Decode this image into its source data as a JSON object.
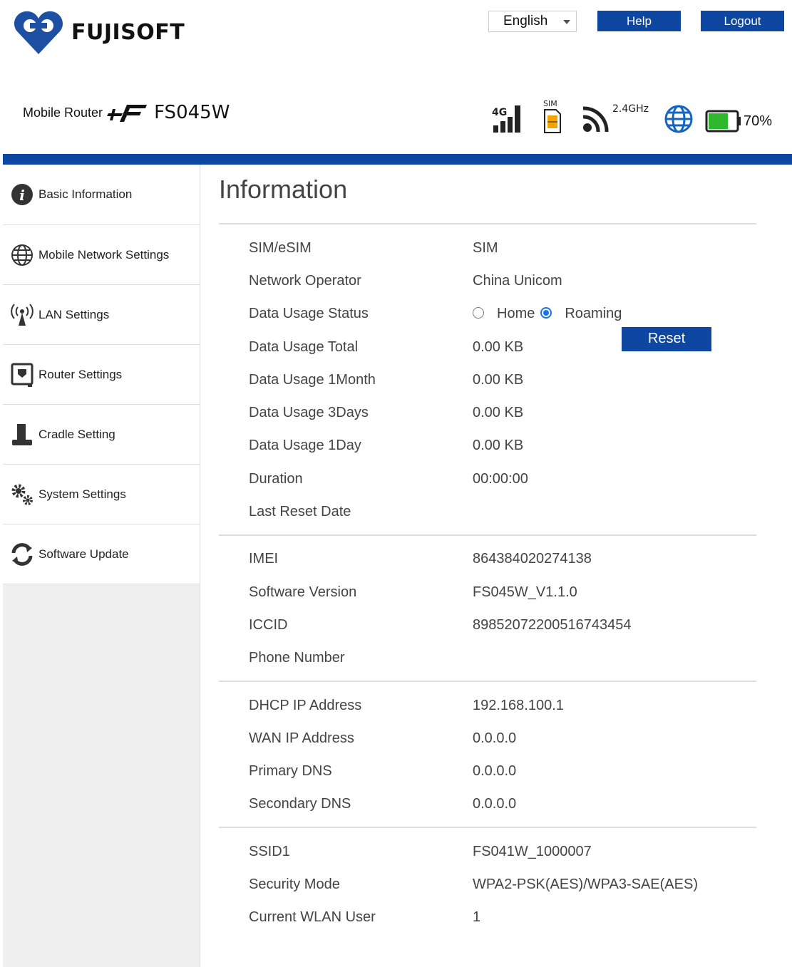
{
  "header": {
    "brand": "FUJISOFT",
    "language": "English",
    "help_label": "Help",
    "logout_label": "Logout",
    "product_prefix": "Mobile Router",
    "product_model": "FS045W"
  },
  "status": {
    "network_type": "4G",
    "sim_label": "SIM",
    "wifi_band": "2.4GHz",
    "battery_percent": "70%",
    "battery_level": 0.7,
    "battery_color": "#2eb82e"
  },
  "colors": {
    "accent": "#0d47a1"
  },
  "sidebar": {
    "items": [
      {
        "label": "Basic Information",
        "icon": "info-icon"
      },
      {
        "label": "Mobile Network Settings",
        "icon": "globe-icon"
      },
      {
        "label": "LAN Settings",
        "icon": "antenna-icon"
      },
      {
        "label": "Router Settings",
        "icon": "router-icon"
      },
      {
        "label": "Cradle Setting",
        "icon": "cradle-icon"
      },
      {
        "label": "System Settings",
        "icon": "gears-icon"
      },
      {
        "label": "Software Update",
        "icon": "refresh-icon"
      }
    ]
  },
  "main": {
    "title": "Information",
    "sim": {
      "label": "SIM/eSIM",
      "value": "SIM"
    },
    "operator": {
      "label": "Network Operator",
      "value": "China Unicom"
    },
    "usage_status": {
      "label": "Data Usage Status",
      "home": "Home",
      "roaming": "Roaming",
      "selected": "Roaming"
    },
    "usage_total": {
      "label": "Data Usage Total",
      "value": "0.00 KB",
      "reset_label": "Reset"
    },
    "usage_1month": {
      "label": "Data Usage 1Month",
      "value": "0.00 KB"
    },
    "usage_3days": {
      "label": "Data Usage 3Days",
      "value": "0.00 KB"
    },
    "usage_1day": {
      "label": "Data Usage 1Day",
      "value": "0.00 KB"
    },
    "duration": {
      "label": "Duration",
      "value": "00:00:00"
    },
    "last_reset": {
      "label": "Last Reset Date",
      "value": ""
    },
    "imei": {
      "label": "IMEI",
      "value": "864384020274138"
    },
    "software_version": {
      "label": "Software Version",
      "value": "FS045W_V1.1.0"
    },
    "iccid": {
      "label": "ICCID",
      "value": "89852072200516743454"
    },
    "phone": {
      "label": "Phone Number",
      "value": ""
    },
    "dhcp_ip": {
      "label": "DHCP IP Address",
      "value": "192.168.100.1"
    },
    "wan_ip": {
      "label": "WAN IP Address",
      "value": "0.0.0.0"
    },
    "primary_dns": {
      "label": "Primary DNS",
      "value": "0.0.0.0"
    },
    "secondary_dns": {
      "label": "Secondary DNS",
      "value": "0.0.0.0"
    },
    "ssid1": {
      "label": "SSID1",
      "value": "FS041W_1000007"
    },
    "security_mode": {
      "label": "Security Mode",
      "value": "WPA2-PSK(AES)/WPA3-SAE(AES)"
    },
    "wlan_users": {
      "label": "Current WLAN User",
      "value": "1"
    }
  }
}
